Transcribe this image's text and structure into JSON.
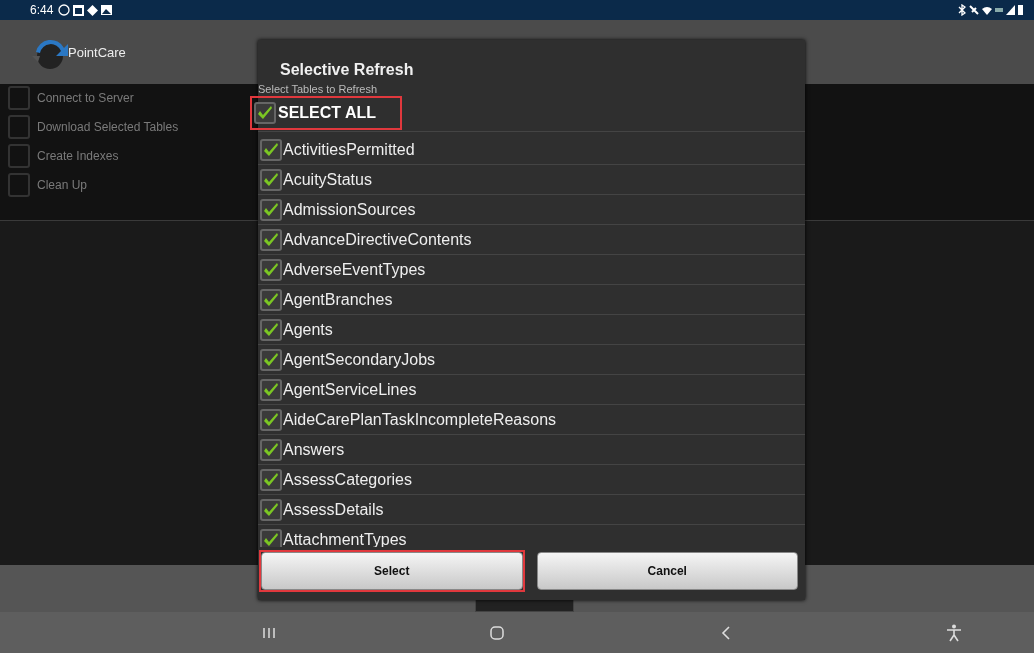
{
  "status_bar": {
    "time": "6:44"
  },
  "app": {
    "title": "PointCare"
  },
  "steps": [
    {
      "label": "Connect to Server",
      "checked": false
    },
    {
      "label": "Download Selected Tables",
      "checked": false
    },
    {
      "label": "Create Indexes",
      "checked": false
    },
    {
      "label": "Clean Up",
      "checked": false
    }
  ],
  "dialog": {
    "title": "Selective Refresh",
    "subtitle": "Select Tables to Refresh",
    "select_all": {
      "label": "SELECT ALL",
      "checked": true,
      "highlighted": true
    },
    "tables": [
      {
        "label": "ActivitiesPermitted",
        "checked": true
      },
      {
        "label": "AcuityStatus",
        "checked": true
      },
      {
        "label": "AdmissionSources",
        "checked": true
      },
      {
        "label": "AdvanceDirectiveContents",
        "checked": true
      },
      {
        "label": "AdverseEventTypes",
        "checked": true
      },
      {
        "label": "AgentBranches",
        "checked": true
      },
      {
        "label": "Agents",
        "checked": true
      },
      {
        "label": "AgentSecondaryJobs",
        "checked": true
      },
      {
        "label": "AgentServiceLines",
        "checked": true
      },
      {
        "label": "AideCarePlanTaskIncompleteReasons",
        "checked": true
      },
      {
        "label": "Answers",
        "checked": true
      },
      {
        "label": "AssessCategories",
        "checked": true
      },
      {
        "label": "AssessDetails",
        "checked": true
      },
      {
        "label": "AttachmentTypes",
        "checked": true
      }
    ],
    "buttons": [
      {
        "label": "Select",
        "highlighted": true
      },
      {
        "label": "Cancel",
        "highlighted": false
      }
    ]
  }
}
